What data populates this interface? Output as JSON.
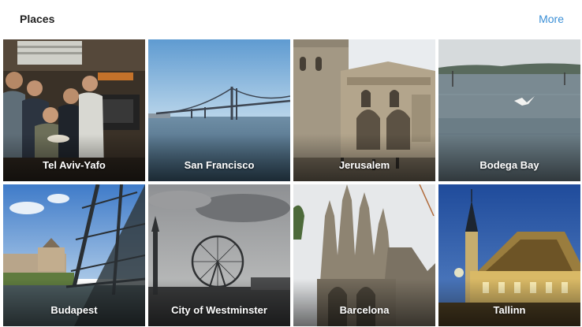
{
  "header": {
    "title": "Places",
    "more_label": "More"
  },
  "colors": {
    "accent": "#3b8fd6"
  },
  "places": [
    {
      "label": "Tel Aviv-Yafo"
    },
    {
      "label": "San Francisco"
    },
    {
      "label": "Jerusalem"
    },
    {
      "label": "Bodega Bay"
    },
    {
      "label": "Budapest"
    },
    {
      "label": "City of Westminster"
    },
    {
      "label": "Barcelona"
    },
    {
      "label": "Tallinn"
    }
  ]
}
